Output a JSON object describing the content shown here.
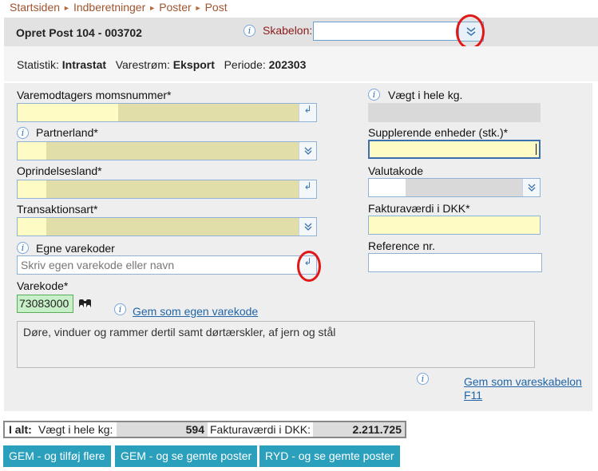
{
  "breadcrumb": [
    "Startsiden",
    "Indberetninger",
    "Poster",
    "Post"
  ],
  "header": {
    "title": "Opret Post 104 - 003702",
    "skabelon_label": "Skabelon:",
    "skabelon_value": ""
  },
  "stats": {
    "statistik_label": "Statistik:",
    "statistik_value": "Intrastat",
    "varestrom_label": "Varestrøm:",
    "varestrom_value": "Eksport",
    "periode_label": "Periode:",
    "periode_value": "202303"
  },
  "form": {
    "momsnummer_label": "Varemodtagers momsnummer*",
    "partnerland_label": "Partnerland*",
    "oprindelsesland_label": "Oprindelsesland*",
    "transaktionsart_label": "Transaktionsart*",
    "egne_label": "Egne varekoder",
    "egne_placeholder": "Skriv egen varekode eller navn",
    "varekode_label": "Varekode*",
    "varekode_value": "73083000",
    "gem_egen_link": "Gem som egen varekode",
    "description": "Døre, vinduer og rammer dertil samt dørtærskler, af jern og stål",
    "vaegt_label": "Vægt i hele kg.",
    "supplerende_label": "Supplerende enheder (stk.)*",
    "valutakode_label": "Valutakode",
    "fakturavaerdi_label": "Fakturaværdi i DKK*",
    "reference_label": "Reference nr.",
    "gem_vareskabelon_link": "Gem som vareskabelon",
    "gem_vareskabelon_shortcut": "F11"
  },
  "totals": {
    "label": "I alt:",
    "vaegt_label": "Vægt i hele kg:",
    "vaegt_value": "594",
    "faktura_label": "Fakturaværdi i DKK:",
    "faktura_value": "2.211.725"
  },
  "buttons": {
    "gem_tilfoj": "GEM - og tilføj flere",
    "gem_se": "GEM - og se gemte poster",
    "ryd_se": "RYD - og se gemte poster"
  },
  "info_glyph": "i",
  "colors": {
    "accent_button": "#2aa0bc",
    "highlight_red": "#e01818",
    "required_yellow": "#fffbc4",
    "varekode_green": "#c8f0c8"
  }
}
